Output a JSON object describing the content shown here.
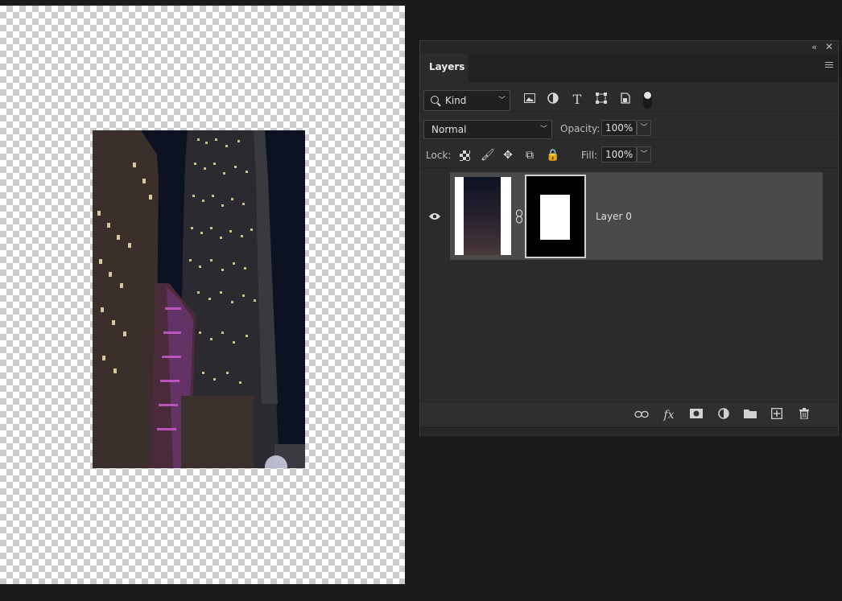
{
  "panel": {
    "tab_label": "Layers",
    "filter": {
      "kind_label": "Kind",
      "icons": [
        "image-filter-icon",
        "adjustment-filter-icon",
        "type-filter-icon",
        "shape-filter-icon",
        "smart-object-filter-icon"
      ]
    },
    "blend_mode": "Normal",
    "opacity_label": "Opacity:",
    "opacity_value": "100%",
    "lock_label": "Lock:",
    "fill_label": "Fill:",
    "fill_value": "100%",
    "type_glyph": "T",
    "layers": [
      {
        "name": "Layer 0",
        "visible": true,
        "has_mask": true
      }
    ],
    "footer_icons": [
      "link-layers-icon",
      "fx-icon",
      "add-mask-icon",
      "new-adjustment-icon",
      "new-group-icon",
      "new-layer-icon",
      "delete-layer-icon"
    ],
    "fx_label": "fx"
  },
  "colors": {
    "panel_bg": "#2b2b2b",
    "selected_layer_bg": "#4a4a4a",
    "app_bg": "#1b1b1b"
  }
}
